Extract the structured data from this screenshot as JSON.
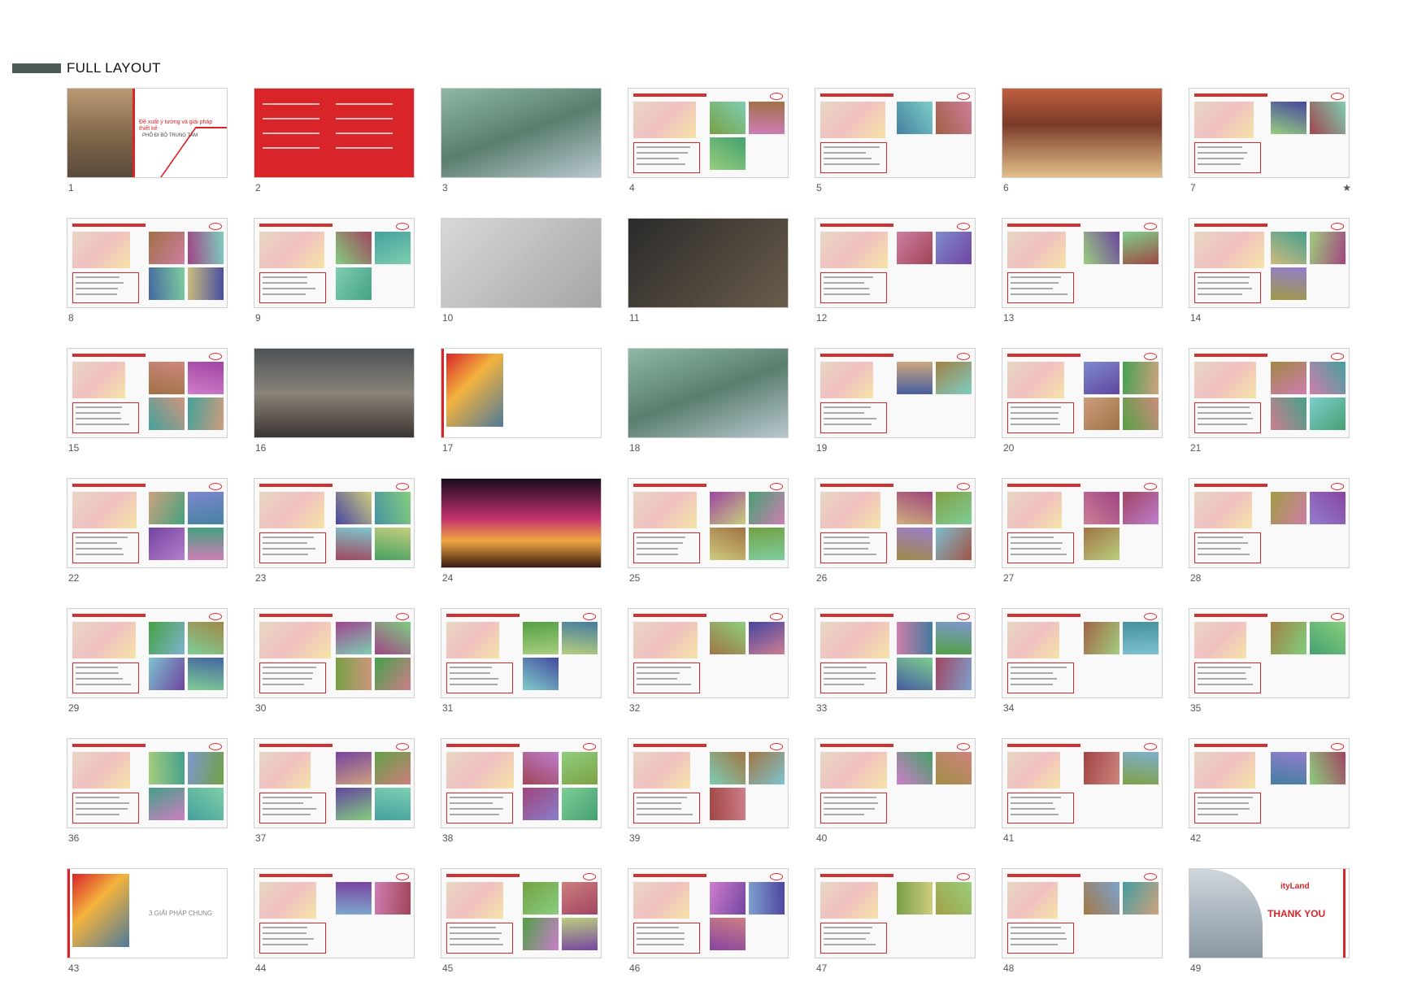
{
  "header": {
    "title": "FULL LAYOUT",
    "accent": "#4b5a57"
  },
  "brand_red": "#d9252a",
  "slides": [
    {
      "num": "1",
      "style": "title"
    },
    {
      "num": "2",
      "style": "red"
    },
    {
      "num": "3",
      "style": "aerial"
    },
    {
      "num": "4",
      "style": "white"
    },
    {
      "num": "5",
      "style": "white"
    },
    {
      "num": "6",
      "style": "photo1"
    },
    {
      "num": "7",
      "style": "white",
      "star": true
    },
    {
      "num": "8",
      "style": "white"
    },
    {
      "num": "9",
      "style": "white"
    },
    {
      "num": "10",
      "style": "gray"
    },
    {
      "num": "11",
      "style": "dark"
    },
    {
      "num": "12",
      "style": "white"
    },
    {
      "num": "13",
      "style": "white"
    },
    {
      "num": "14",
      "style": "white"
    },
    {
      "num": "15",
      "style": "white"
    },
    {
      "num": "16",
      "style": "photo2"
    },
    {
      "num": "17",
      "style": "sec"
    },
    {
      "num": "18",
      "style": "aerial"
    },
    {
      "num": "19",
      "style": "white"
    },
    {
      "num": "20",
      "style": "white"
    },
    {
      "num": "21",
      "style": "white"
    },
    {
      "num": "22",
      "style": "white"
    },
    {
      "num": "23",
      "style": "white"
    },
    {
      "num": "24",
      "style": "concert"
    },
    {
      "num": "25",
      "style": "white"
    },
    {
      "num": "26",
      "style": "white"
    },
    {
      "num": "27",
      "style": "white"
    },
    {
      "num": "28",
      "style": "white"
    },
    {
      "num": "29",
      "style": "white"
    },
    {
      "num": "30",
      "style": "white"
    },
    {
      "num": "31",
      "style": "white"
    },
    {
      "num": "32",
      "style": "white"
    },
    {
      "num": "33",
      "style": "white"
    },
    {
      "num": "34",
      "style": "white"
    },
    {
      "num": "35",
      "style": "white"
    },
    {
      "num": "36",
      "style": "white"
    },
    {
      "num": "37",
      "style": "white"
    },
    {
      "num": "38",
      "style": "white"
    },
    {
      "num": "39",
      "style": "white"
    },
    {
      "num": "40",
      "style": "white"
    },
    {
      "num": "41",
      "style": "white"
    },
    {
      "num": "42",
      "style": "white"
    },
    {
      "num": "43",
      "style": "sec"
    },
    {
      "num": "44",
      "style": "white"
    },
    {
      "num": "45",
      "style": "white"
    },
    {
      "num": "46",
      "style": "white"
    },
    {
      "num": "47",
      "style": "white"
    },
    {
      "num": "48",
      "style": "white"
    },
    {
      "num": "49",
      "style": "thanks"
    }
  ],
  "slide_text": {
    "s1_title": "Đề xuất ý tưởng và giải pháp thiết kế",
    "s1_sub": "PHỐ ĐI BỘ TRUNG TÂM",
    "s43_label": "3.GIẢI PHÁP CHUNG",
    "s49_brand": "ityLand",
    "s49_thanks": "THANK YOU"
  }
}
